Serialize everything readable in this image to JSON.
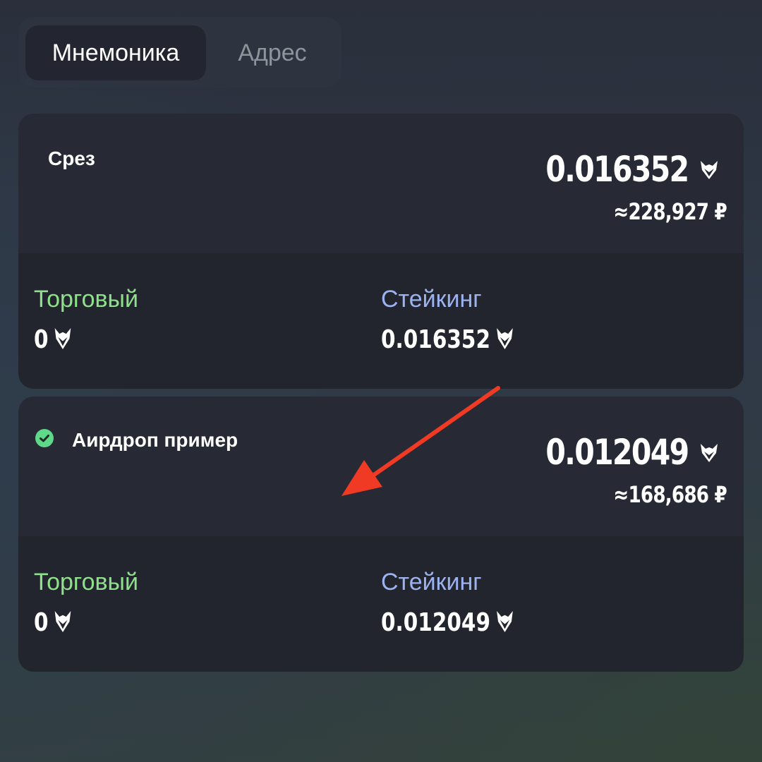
{
  "tabs": {
    "mnemonic_label": "Мнемоника",
    "address_label": "Адрес"
  },
  "wallets": [
    {
      "title": "Срез",
      "selected": false,
      "amount": "0.016352",
      "fiat": "≈228,927 ₽",
      "trading_label": "Торговый",
      "trading_value": "0",
      "staking_label": "Стейкинг",
      "staking_value": "0.016352"
    },
    {
      "title": "Аирдроп пример",
      "selected": true,
      "amount": "0.012049",
      "fiat": "≈168,686 ₽",
      "trading_label": "Торговый",
      "trading_value": "0",
      "staking_label": "Стейкинг",
      "staking_value": "0.012049"
    }
  ],
  "colors": {
    "trading": "#8fe08a",
    "staking": "#9db3f0",
    "check": "#5fd88a",
    "annotation_arrow": "#f03a24"
  },
  "icons": {
    "coin": "fox-coin-icon",
    "selected": "check-circle-icon"
  }
}
